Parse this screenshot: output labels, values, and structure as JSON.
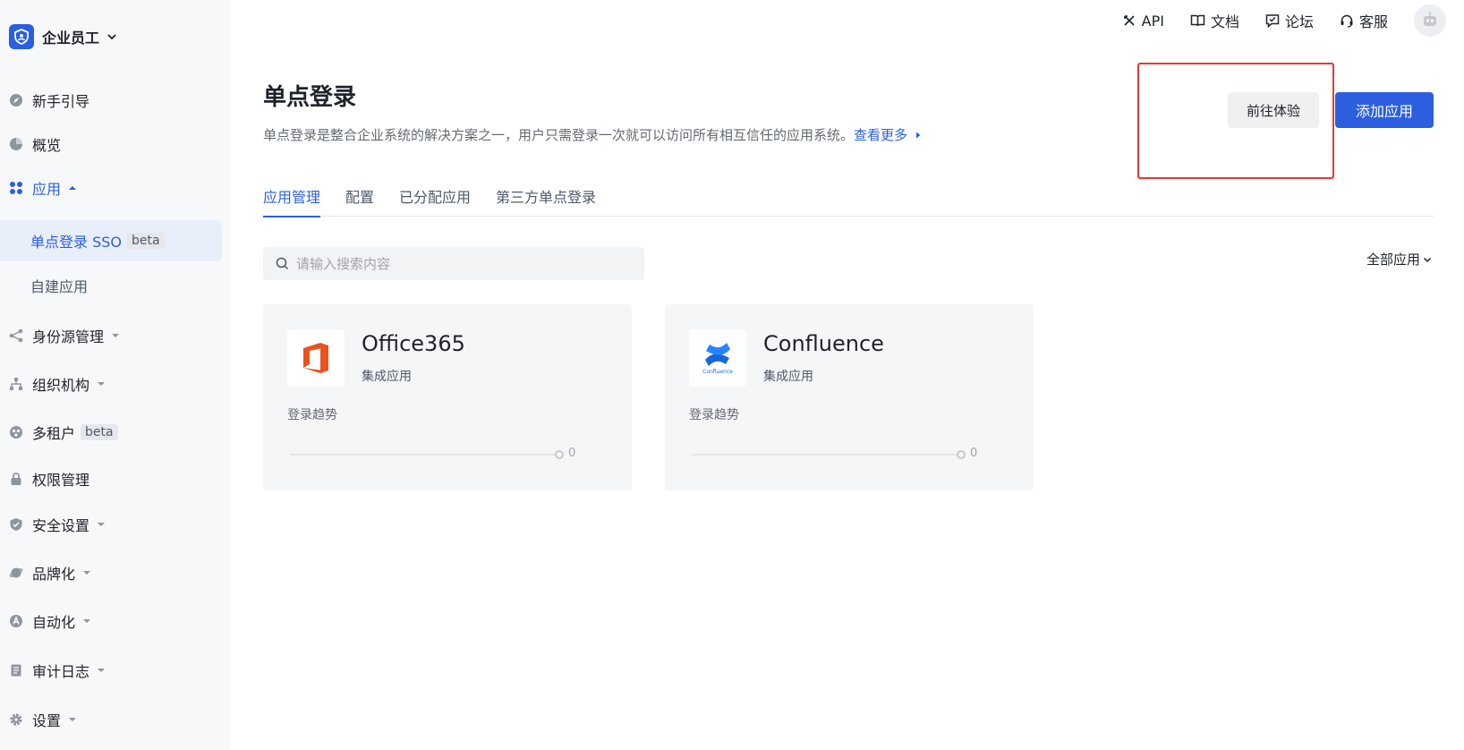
{
  "brand": {
    "name": "企业员工"
  },
  "sidebar": {
    "items": [
      {
        "label": "新手引导"
      },
      {
        "label": "概览"
      },
      {
        "label": "应用"
      },
      {
        "label": "单点登录 SSO",
        "tag": "beta"
      },
      {
        "label": "自建应用"
      },
      {
        "label": "身份源管理"
      },
      {
        "label": "组织机构"
      },
      {
        "label": "多租户",
        "tag": "beta"
      },
      {
        "label": "权限管理"
      },
      {
        "label": "安全设置"
      },
      {
        "label": "品牌化"
      },
      {
        "label": "自动化"
      },
      {
        "label": "审计日志"
      },
      {
        "label": "设置"
      }
    ]
  },
  "topbar": {
    "api": "API",
    "docs": "文档",
    "forum": "论坛",
    "support": "客服"
  },
  "header": {
    "title": "单点登录",
    "description": "单点登录是整合企业系统的解决方案之一，用户只需登录一次就可以访问所有相互信任的应用系统。",
    "more_link": "查看更多",
    "try_button": "前往体验",
    "add_button": "添加应用"
  },
  "tabs": [
    {
      "label": "应用管理"
    },
    {
      "label": "配置"
    },
    {
      "label": "已分配应用"
    },
    {
      "label": "第三方单点登录"
    }
  ],
  "search": {
    "placeholder": "请输入搜索内容"
  },
  "filter": {
    "label": "全部应用"
  },
  "apps": [
    {
      "name": "Office365",
      "type": "集成应用",
      "trend_label": "登录趋势",
      "logins": "0"
    },
    {
      "name": "Confluence",
      "type": "集成应用",
      "trend_label": "登录趋势",
      "logins": "0",
      "logo_text": "Confluence"
    }
  ],
  "colors": {
    "primary": "#2b5fe0",
    "highlight": "#e53935",
    "office": "#e8531f",
    "confluence": "#1868db"
  }
}
